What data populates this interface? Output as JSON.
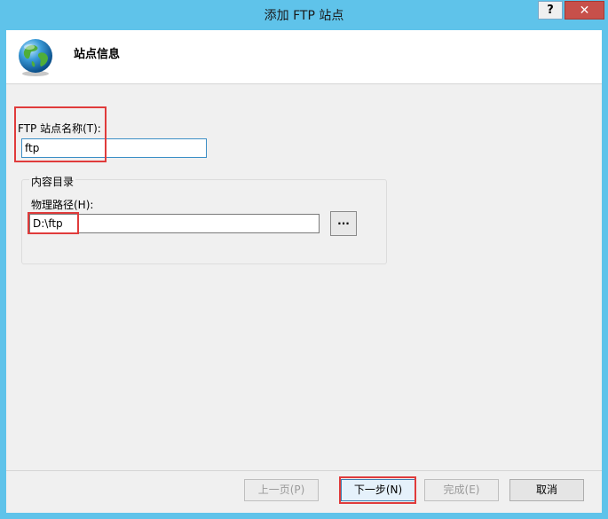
{
  "window": {
    "title": "添加 FTP 站点",
    "help_label": "?",
    "close_label": "✕"
  },
  "header": {
    "title": "站点信息",
    "icon": "globe-icon"
  },
  "site_name": {
    "label": "FTP 站点名称(T):",
    "value": "ftp"
  },
  "content_dir": {
    "group_label": "内容目录",
    "path_label": "物理路径(H):",
    "path_value": "D:\\ftp",
    "browse_label": "..."
  },
  "buttons": {
    "prev": "上一页(P)",
    "next": "下一步(N)",
    "finish": "完成(E)",
    "cancel": "取消"
  },
  "colors": {
    "title_bar": "#5fc3ea",
    "close": "#c7504a",
    "highlight": "#e03b3b"
  }
}
